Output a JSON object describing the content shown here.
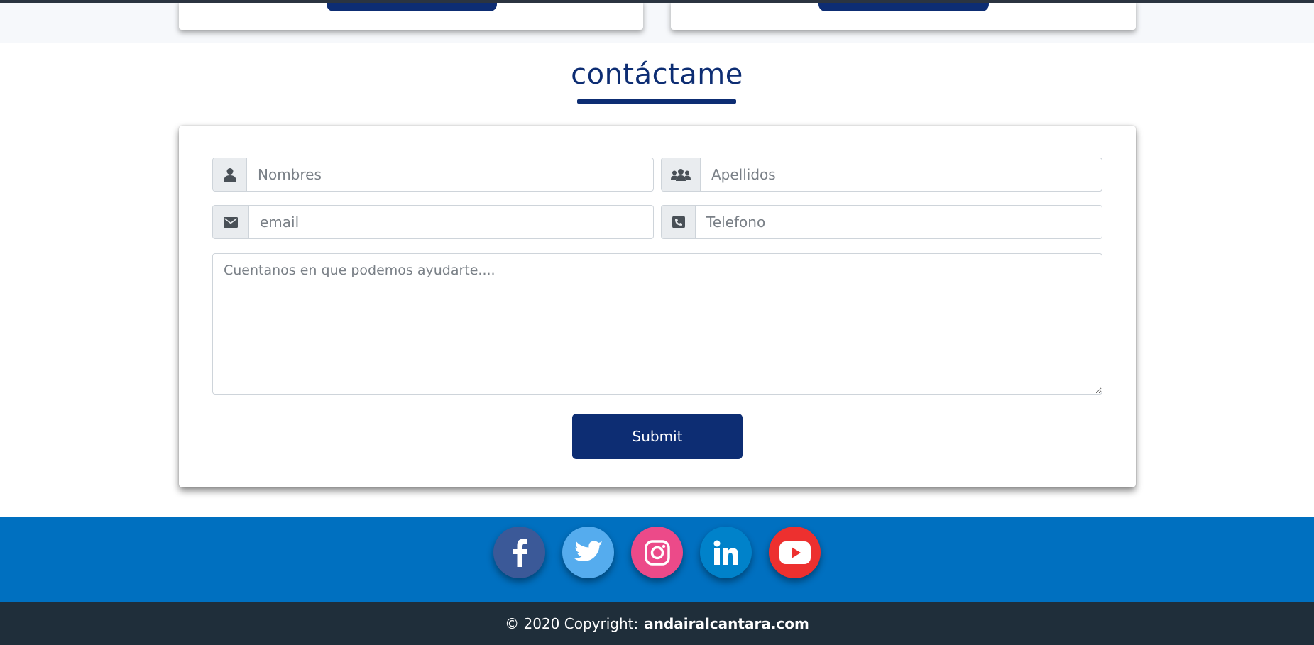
{
  "section": {
    "title": "contáctame"
  },
  "form": {
    "first_name_placeholder": "Nombres",
    "last_name_placeholder": "Apellidos",
    "email_placeholder": "email",
    "phone_placeholder": "Telefono",
    "message_placeholder": "Cuentanos en que podemos ayudarte....",
    "submit_label": "Submit"
  },
  "social": [
    {
      "name": "facebook",
      "icon": "facebook-icon",
      "color": "#3b5998"
    },
    {
      "name": "twitter",
      "icon": "twitter-icon",
      "color": "#55acee"
    },
    {
      "name": "instagram",
      "icon": "instagram-icon",
      "color": "#ec4a89"
    },
    {
      "name": "linkedin",
      "icon": "linkedin-icon",
      "color": "#0082ca"
    },
    {
      "name": "youtube",
      "icon": "youtube-icon",
      "color": "#ed302f"
    }
  ],
  "footer": {
    "copyright_text": "© 2020 Copyright:",
    "site_link": "andairalcantara.com"
  },
  "colors": {
    "primary": "#0d2d73",
    "social_band": "#0070c0",
    "footer_bg": "#1f2e3a"
  }
}
